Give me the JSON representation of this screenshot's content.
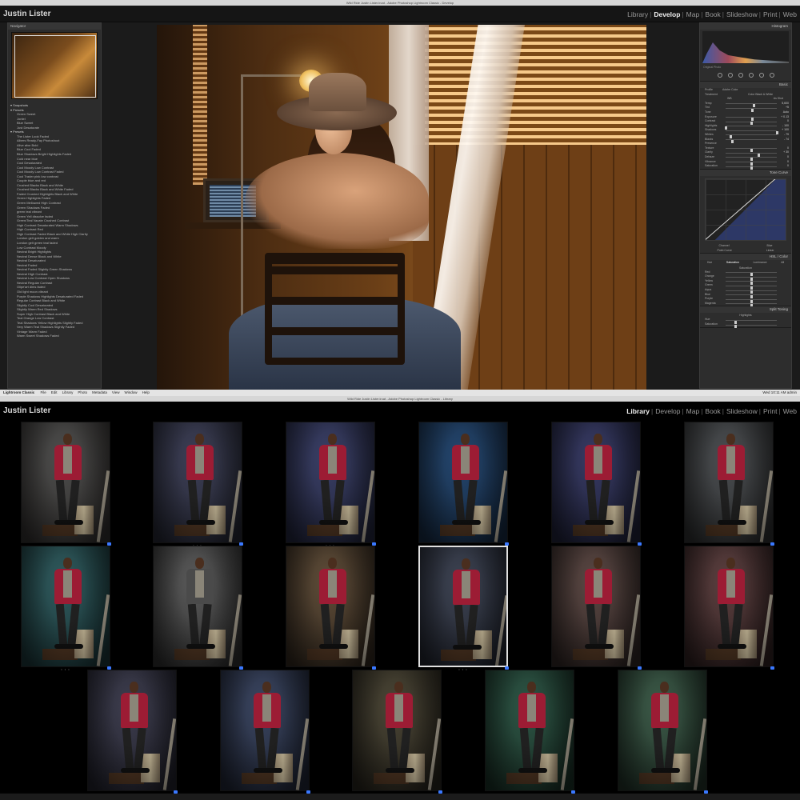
{
  "top": {
    "titlebar": "Wild Ride Justin Lister.lrcat - Adobe Photoshop Lightroom Classic - Develop",
    "identity": "Justin Lister",
    "modules": [
      "Library",
      "Develop",
      "Map",
      "Book",
      "Slideshow",
      "Print",
      "Web"
    ],
    "active_module": "Develop",
    "navigator": {
      "title": "Navigator",
      "zoom": "FIT  FILL  100%  200%"
    },
    "presets": [
      {
        "label": "Snapshots",
        "folder": true
      },
      {
        "label": "Presets",
        "folder": true
      },
      {
        "label": "Green Sweet",
        "folder": false
      },
      {
        "label": "Jontel",
        "folder": false
      },
      {
        "label": "Blue Sweet",
        "folder": false
      },
      {
        "label": "Just Desaturate",
        "folder": false
      },
      {
        "label": "Presets",
        "folder": true
      },
      {
        "label": "The Lister Look Faded",
        "folder": false
      },
      {
        "label": "Albers Ready-Fay Photoshoot",
        "folder": false
      },
      {
        "label": "Alive afxe Bold",
        "folder": false
      },
      {
        "label": "Blue Cool Faded",
        "folder": false
      },
      {
        "label": "Blue Shadows Bright Highlights Faded",
        "folder": false
      },
      {
        "label": "Cold near blue",
        "folder": false
      },
      {
        "label": "Cool Desaturated",
        "folder": false
      },
      {
        "label": "Cool Moody Low Contrast",
        "folder": false
      },
      {
        "label": "Cool Moody Low Contrast Faded",
        "folder": false
      },
      {
        "label": "Cool Trader pink low contrast",
        "folder": false
      },
      {
        "label": "Couple blue and red",
        "folder": false
      },
      {
        "label": "Crushed Blacks Black and White",
        "folder": false
      },
      {
        "label": "Crushed Blacks Black and White Faded",
        "folder": false
      },
      {
        "label": "Faded Crushed Highlights Black and White",
        "folder": false
      },
      {
        "label": "Green Highlights Faded",
        "folder": false
      },
      {
        "label": "Green Mellowed High Contrast",
        "folder": false
      },
      {
        "label": "Green Shadows Faded",
        "folder": false
      },
      {
        "label": "green teal vibrant",
        "folder": false
      },
      {
        "label": "Green Yell dissolve faded",
        "folder": false
      },
      {
        "label": "Green/Teal Vacate Crushed Contrast",
        "folder": false
      },
      {
        "label": "High Contrast Desaturated Warm Shadows",
        "folder": false
      },
      {
        "label": "High Contrast Red",
        "folder": false
      },
      {
        "label": "High Contrast Faded Black and White High Clarity",
        "folder": false
      },
      {
        "label": "London gelt golden and warm",
        "folder": false
      },
      {
        "label": "London gelt green teal faded",
        "folder": false
      },
      {
        "label": "Low Contrast Moody",
        "folder": false
      },
      {
        "label": "Neutral Bright Highlights",
        "folder": false
      },
      {
        "label": "Neutral Dense Black and White",
        "folder": false
      },
      {
        "label": "Neutral Desaturated",
        "folder": false
      },
      {
        "label": "Neutral Faded",
        "folder": false
      },
      {
        "label": "Neutral Faded Slightly Green Shadows",
        "folder": false
      },
      {
        "label": "Neutral High Contrast",
        "folder": false
      },
      {
        "label": "Neutral Low Contrast Open Shadows",
        "folder": false
      },
      {
        "label": "Neutral Regular Contrast",
        "folder": false
      },
      {
        "label": "Olipe'art dims faded",
        "folder": false
      },
      {
        "label": "Old light moon vibrant",
        "folder": false
      },
      {
        "label": "Purple Shadows Highlights Desaturated Faded",
        "folder": false
      },
      {
        "label": "Regular Contrast Black and White",
        "folder": false
      },
      {
        "label": "Slightly Cool Desaturated",
        "folder": false
      },
      {
        "label": "Slightly Warm Red Shadows",
        "folder": false
      },
      {
        "label": "Super High Contrast Black and White",
        "folder": false
      },
      {
        "label": "Teal Orange Low Contrast",
        "folder": false
      },
      {
        "label": "Teal Shadows Yellow Highlights Slightly Faded",
        "folder": false
      },
      {
        "label": "Very Warm Teal Shadows Slightly Faded",
        "folder": false
      },
      {
        "label": "Vintage Warm Faded",
        "folder": false
      },
      {
        "label": "Warm Sweet Shadows Faded",
        "folder": false
      }
    ],
    "right_panel": {
      "histogram_title": "Histogram",
      "histogram_caption": "Original Photo",
      "basic_title": "Basic",
      "profile_label": "Profile",
      "profile_value": "Adobe Color",
      "treatment_label": "Treatment",
      "treatment_options": "Color   Black & White",
      "wb_label": "WB",
      "wb_value": "As Shot",
      "sliders": [
        {
          "label": "Temp",
          "value": "5,600",
          "pos": 0.55
        },
        {
          "label": "Tint",
          "value": "+5",
          "pos": 0.52
        },
        {
          "label": "Tone",
          "value": "Auto",
          "pos": -1
        },
        {
          "label": "Exposure",
          "value": "+ 0.13",
          "pos": 0.53
        },
        {
          "label": "Contrast",
          "value": "0",
          "pos": 0.5
        },
        {
          "label": "Highlights",
          "value": "- 100",
          "pos": 0.0
        },
        {
          "label": "Shadows",
          "value": "+ 100",
          "pos": 1.0
        },
        {
          "label": "Whites",
          "value": "- 79",
          "pos": 0.1
        },
        {
          "label": "Blacks",
          "value": "- 74",
          "pos": 0.13
        },
        {
          "label": "Presence",
          "value": "",
          "pos": -1
        },
        {
          "label": "Texture",
          "value": "0",
          "pos": 0.5
        },
        {
          "label": "Clarity",
          "value": "+ 30",
          "pos": 0.65
        },
        {
          "label": "Dehaze",
          "value": "0",
          "pos": 0.5
        },
        {
          "label": "Vibrance",
          "value": "0",
          "pos": 0.5
        },
        {
          "label": "Saturation",
          "value": "0",
          "pos": 0.5
        }
      ],
      "tone_curve_title": "Tone Curve",
      "tone_curve_labels": [
        "Channel",
        "Blue"
      ],
      "point_curve_label": "Point Curve",
      "point_curve_value": "Linear",
      "hsl_title": "HSL / Color",
      "hsl_tabs": [
        "Hue",
        "Saturation",
        "Luminance",
        "All"
      ],
      "hsl_selected": "Saturation",
      "hsl_sub": "Saturation",
      "hsl_sliders": [
        "Red",
        "Orange",
        "Yellow",
        "Green",
        "Aqua",
        "Blue",
        "Purple",
        "Magenta"
      ],
      "split_title": "Split Toning",
      "split_sub": "Highlights",
      "split_sliders": [
        "Hue",
        "Saturation"
      ]
    }
  },
  "bottom": {
    "titlebar": "Wild Ride Justin Lister.lrcat - Adobe Photoshop Lightroom Classic - Library",
    "taskbar_app": "Lightroom Classic",
    "taskbar_menus": [
      "File",
      "Edit",
      "Library",
      "Photo",
      "Metadata",
      "View",
      "Window",
      "Help"
    ],
    "taskbar_right": "Wed 10:11 AM   admin",
    "identity": "Justin Lister",
    "modules": [
      "Library",
      "Develop",
      "Map",
      "Book",
      "Slideshow",
      "Print",
      "Web"
    ],
    "active_module": "Library",
    "thumbnail_tints": [
      [
        "#4d4d4c",
        "#2d2b2a"
      ],
      [
        "#3c3e55",
        "#22242f"
      ],
      [
        "#3a3f66",
        "#1f2237"
      ],
      [
        "#24466e",
        "#14263c"
      ],
      [
        "#373a63",
        "#1c1e33"
      ],
      [
        "#4a4d50",
        "#2a2b2c"
      ],
      [
        "#2f5a5d",
        "#183032"
      ],
      [
        "#5a5a5a",
        "#2a2a2a"
      ],
      [
        "#5e4c38",
        "#2d241b"
      ],
      [
        "#3d4352",
        "#1e212a"
      ],
      [
        "#5a4743",
        "#2c2321"
      ],
      [
        "#5b3f3f",
        "#2c1e1e"
      ],
      [
        "#3d3d4e",
        "#1f1f28"
      ],
      [
        "#3a4560",
        "#1d2230"
      ],
      [
        "#4a4535",
        "#24211a"
      ],
      [
        "#2d5545",
        "#172b22"
      ],
      [
        "#3c5a48",
        "#1e2d24"
      ]
    ],
    "bw_index": 7,
    "selected_index": 9,
    "dots_under": [
      1,
      2,
      6,
      9
    ],
    "dots_glyph": "• • •"
  }
}
